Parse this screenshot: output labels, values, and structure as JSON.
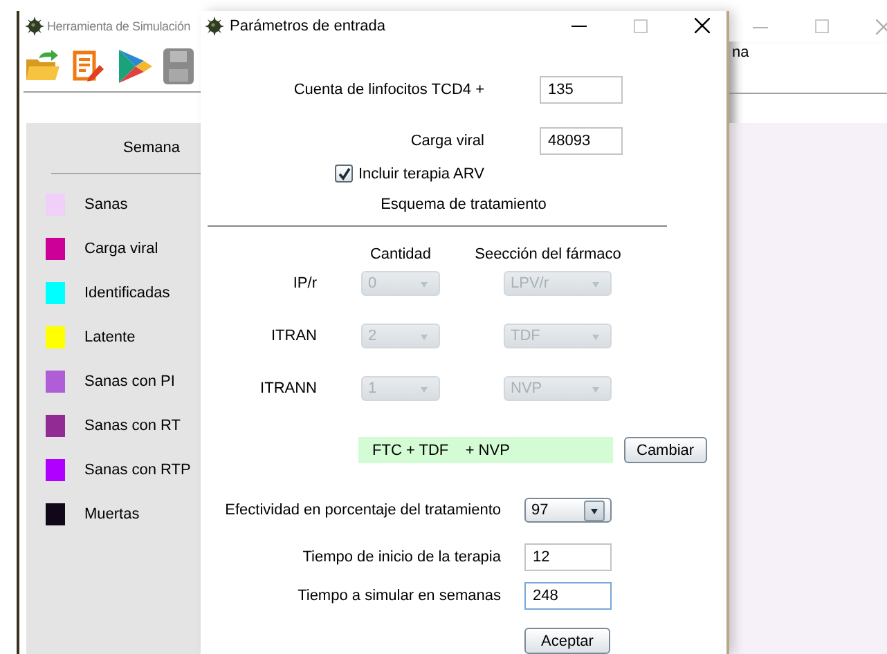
{
  "background_window": {
    "title": "Herramienta de Simulación",
    "menu_text": "na",
    "week_label": "Semana",
    "legend": [
      {
        "label": "Sanas",
        "color": "#f0d0f8"
      },
      {
        "label": "Carga viral",
        "color": "#cc0099"
      },
      {
        "label": "Identificadas",
        "color": "#00ffff"
      },
      {
        "label": "Latente",
        "color": "#ffff00"
      },
      {
        "label": "Sanas con PI",
        "color": "#b05ed8"
      },
      {
        "label": "Sanas con RT",
        "color": "#922b94"
      },
      {
        "label": "Sanas con RTP",
        "color": "#b000ff"
      },
      {
        "label": "Muertas",
        "color": "#100818"
      }
    ]
  },
  "dialog": {
    "title": "Parámetros de entrada",
    "fields": [
      {
        "label": "Cuenta de linfocitos TCD4 +",
        "value": "135"
      },
      {
        "label": "Carga viral",
        "value": "48093"
      }
    ],
    "include_arv": {
      "label": "Incluir terapia ARV",
      "checked": true
    },
    "section": "Esquema de tratamiento",
    "columns": [
      "Cantidad",
      "Seección del fármaco"
    ],
    "drug_rows": [
      {
        "label": "IP/r",
        "quantity": {
          "value": "0",
          "disabled": true
        },
        "drug": {
          "value": "LPV/r",
          "disabled": true
        }
      },
      {
        "label": "ITRAN",
        "quantity": {
          "value": "2",
          "disabled": true
        },
        "drug": {
          "value": "TDF",
          "disabled": true
        }
      },
      {
        "label": "ITRANN",
        "quantity": {
          "value": "1",
          "disabled": true
        },
        "drug": {
          "value": "NVP",
          "disabled": true
        }
      }
    ],
    "scheme": "FTC + TDF    + NVP",
    "change_button": "Cambiar",
    "effectiveness": {
      "label": "Efectividad en porcentaje del tratamiento",
      "value": "97",
      "disabled": false
    },
    "time_fields": [
      {
        "label": "Tiempo de inicio de la terapia",
        "value": "12",
        "focused": false
      },
      {
        "label": "Tiempo a simular en semanas",
        "value": "248",
        "focused": true
      }
    ],
    "accept_button": "Aceptar"
  }
}
